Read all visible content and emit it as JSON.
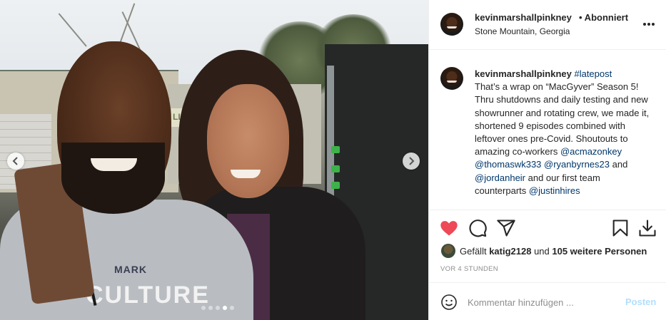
{
  "post": {
    "username": "kevinmarshallpinkney",
    "follow_status": "• Abonniert",
    "location": "Stone Mountain, Georgia"
  },
  "media": {
    "sign_text": "LLA",
    "shirt_text_1": "MARK",
    "shirt_text_2": "CULTURE",
    "carousel": {
      "total": 5,
      "active_index": 3
    },
    "icons": {
      "prev": "chevron-left-icon",
      "next": "chevron-right-icon"
    }
  },
  "caption": {
    "username": "kevinmarshallpinkney",
    "hashtag": "#latepost",
    "text_1": "That’s a wrap on “MacGyver” Season 5! Thru shutdowns and daily testing and new showrunner and rotating crew, we made it, shortened 9 episodes combined with leftover ones pre-Covid. Shoutouts to amazing co-workers ",
    "mention_1": "@acmazonkey",
    "mention_2": "@thomaswk333",
    "mention_3": "@ryanbyrnes23",
    "and_1": " and ",
    "mention_4": "@jordanheir",
    "text_2": " and our first team counterparts ",
    "mention_5": "@justinhires"
  },
  "actions": {
    "icons": [
      "heart-icon",
      "comment-icon",
      "share-icon",
      "bookmark-icon",
      "download-icon"
    ],
    "like_color": "#ed4956"
  },
  "likes": {
    "prefix": "Gefällt ",
    "liker": "katig2128",
    "middle": " und ",
    "others": "105 weitere Personen"
  },
  "timestamp": "VOR 4 STUNDEN",
  "comment": {
    "placeholder": "Kommentar hinzufügen ...",
    "post_label": "Posten"
  }
}
